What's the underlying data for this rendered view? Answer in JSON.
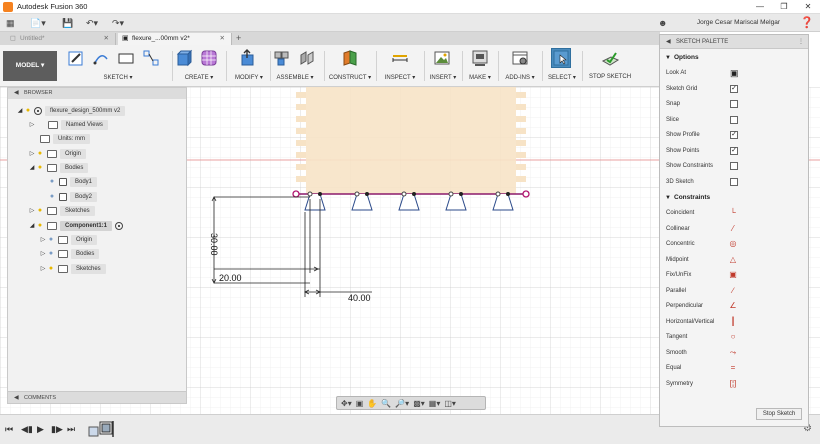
{
  "window": {
    "title": "Autodesk Fusion 360"
  },
  "quickbar": {
    "user": "Jorge Cesar Mariscal Melgar",
    "help": "?"
  },
  "tabs": [
    {
      "label": "Untitled*"
    },
    {
      "label": "flexure_...00mm v2*"
    }
  ],
  "toolbar": {
    "workspace": "MODEL",
    "groups": {
      "sketch": "SKETCH",
      "create": "CREATE",
      "modify": "MODIFY",
      "assemble": "ASSEMBLE",
      "construct": "CONSTRUCT",
      "inspect": "INSPECT",
      "insert": "INSERT",
      "make": "MAKE",
      "addins": "ADD-INS",
      "select": "SELECT",
      "stop_sketch": "STOP SKETCH"
    }
  },
  "browser": {
    "header": "BROWSER",
    "items": [
      {
        "label": "flexure_design_500mm v2"
      },
      {
        "label": "Named Views"
      },
      {
        "label": "Units: mm"
      },
      {
        "label": "Origin"
      },
      {
        "label": "Bodies"
      },
      {
        "label": "Body1"
      },
      {
        "label": "Body2"
      },
      {
        "label": "Sketches"
      },
      {
        "label": "Component1:1"
      },
      {
        "label": "Origin"
      },
      {
        "label": "Bodies"
      },
      {
        "label": "Sketches"
      }
    ]
  },
  "comments": {
    "label": "COMMENTS"
  },
  "sketch": {
    "dims": {
      "vertical": "30.00",
      "horizontal_1": "20.00",
      "horizontal_2": "40.00"
    }
  },
  "palette": {
    "title": "SKETCH PALETTE",
    "options_label": "Options",
    "options": [
      {
        "label": "Look At",
        "type": "icon",
        "checked": false
      },
      {
        "label": "Sketch Grid",
        "type": "checkbox",
        "checked": true
      },
      {
        "label": "Snap",
        "type": "checkbox",
        "checked": false
      },
      {
        "label": "Slice",
        "type": "checkbox",
        "checked": false
      },
      {
        "label": "Show Profile",
        "type": "checkbox",
        "checked": true
      },
      {
        "label": "Show Points",
        "type": "checkbox",
        "checked": true
      },
      {
        "label": "Show Constraints",
        "type": "checkbox",
        "checked": false
      },
      {
        "label": "3D Sketch",
        "type": "checkbox",
        "checked": false
      }
    ],
    "constraints_label": "Constraints",
    "constraints": [
      {
        "label": "Coincident",
        "icon": "coincident-icon"
      },
      {
        "label": "Collinear",
        "icon": "collinear-icon"
      },
      {
        "label": "Concentric",
        "icon": "concentric-icon"
      },
      {
        "label": "Midpoint",
        "icon": "midpoint-icon"
      },
      {
        "label": "Fix/UnFix",
        "icon": "lock-icon"
      },
      {
        "label": "Parallel",
        "icon": "parallel-icon"
      },
      {
        "label": "Perpendicular",
        "icon": "perpendicular-icon"
      },
      {
        "label": "Horizontal/Vertical",
        "icon": "horizontal-vertical-icon"
      },
      {
        "label": "Tangent",
        "icon": "tangent-icon"
      },
      {
        "label": "Smooth",
        "icon": "smooth-icon"
      },
      {
        "label": "Equal",
        "icon": "equal-icon"
      },
      {
        "label": "Symmetry",
        "icon": "symmetry-icon"
      }
    ],
    "stop_button": "Stop Sketch"
  },
  "colors": {
    "accent": "#4a8bbd",
    "sketch_line": "#8b1a6b",
    "profile_fill": "#f5dcb8",
    "axis_red": "#e8a0a0",
    "grid": "#d6d6d6"
  }
}
